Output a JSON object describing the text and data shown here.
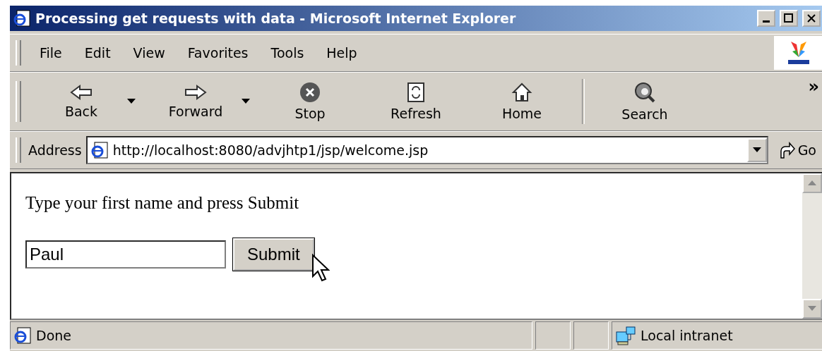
{
  "window": {
    "title": "Processing get requests with data - Microsoft Internet Explorer"
  },
  "menu": [
    "File",
    "Edit",
    "View",
    "Favorites",
    "Tools",
    "Help"
  ],
  "toolbar": [
    {
      "label": "Back",
      "dropdown": true
    },
    {
      "label": "Forward",
      "dropdown": true
    },
    {
      "label": "Stop",
      "dropdown": false
    },
    {
      "label": "Refresh",
      "dropdown": false
    },
    {
      "label": "Home",
      "dropdown": false
    },
    {
      "label": "Search",
      "dropdown": false
    }
  ],
  "toolbar_overflow": "»",
  "address": {
    "label": "Address",
    "value": "http://localhost:8080/advjhtp1/jsp/welcome.jsp",
    "go": "Go"
  },
  "page": {
    "prompt": "Type your first name and press Submit",
    "name_value": "Paul",
    "submit": "Submit"
  },
  "status_bar": {
    "text": "Done",
    "zone": "Local intranet"
  }
}
